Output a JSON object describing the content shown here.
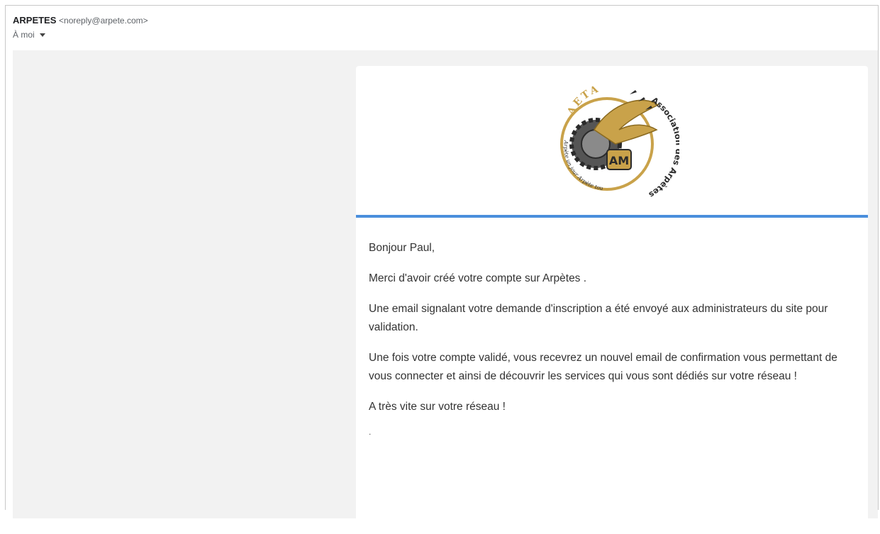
{
  "header": {
    "sender_name": "ARPETES",
    "sender_email": "<noreply@arpete.com>",
    "recipient": "À moi"
  },
  "logo": {
    "arc_top": "AETA",
    "arc_right": "Association des Arpètes",
    "arc_left": "Arpète un jour Arpète toujours !",
    "badge": "AM",
    "colors": {
      "gold": "#c9a24a",
      "dark": "#2b2b2b",
      "gear": "#555555"
    }
  },
  "message": {
    "greeting": "Bonjour Paul,",
    "p1": "Merci d'avoir créé votre compte sur Arpètes .",
    "p2": "Une email signalant votre demande d'inscription a été envoyé aux administrateurs du site pour validation.",
    "p3": "Une fois votre compte validé, vous recevrez un nouvel email de confirmation vous permettant de vous connecter et ainsi de découvrir les services qui vous sont dédiés sur votre réseau !",
    "p4": "A très vite sur votre réseau !",
    "trailing": "."
  },
  "colors": {
    "accent_rule": "#4a8fdc",
    "body_bg": "#f2f2f2"
  }
}
